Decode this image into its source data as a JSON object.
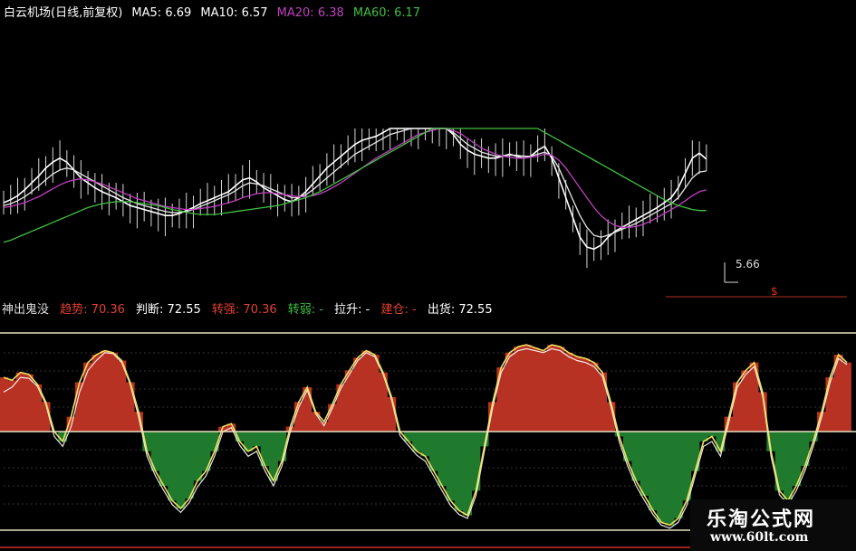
{
  "header": {
    "stock": "白云机场(日线,前复权)",
    "ma": [
      {
        "label": "MA5: 6.69",
        "color": "#ffffff"
      },
      {
        "label": "MA10: 6.57",
        "color": "#ffffff"
      },
      {
        "label": "MA20: 6.38",
        "color": "#c040c0"
      },
      {
        "label": "MA60: 6.17",
        "color": "#40c040"
      }
    ]
  },
  "indicator_header": {
    "items": [
      {
        "label": "神出鬼没",
        "color": "#dddddd"
      },
      {
        "label": "趋势: 70.36",
        "color": "#e04030"
      },
      {
        "label": "判断: 72.55",
        "color": "#ffffff"
      },
      {
        "label": "转强: 70.36",
        "color": "#e04030"
      },
      {
        "label": "转弱: -",
        "color": "#40c040"
      },
      {
        "label": "拉升: -",
        "color": "#ffffff"
      },
      {
        "label": "建仓: -",
        "color": "#e04030"
      },
      {
        "label": "出货: 72.55",
        "color": "#ffffff"
      }
    ]
  },
  "annotations": {
    "low_label": "5.66",
    "mark": "$"
  },
  "watermark": {
    "title": "乐淘公式网",
    "url": "www.60lt.com"
  },
  "colors": {
    "red_fill": "#b83224",
    "green_fill": "#1f7a2e",
    "yellow_line": "#f0e060",
    "ma5": "#ffffff",
    "ma20": "#c040c0",
    "ma60": "#40c040"
  },
  "chart_data": [
    {
      "type": "line",
      "x": [
        0,
        1,
        2,
        3,
        4,
        5,
        6,
        7,
        8,
        9,
        10,
        11,
        12,
        13,
        14,
        15,
        16,
        17,
        18,
        19,
        20,
        21,
        22,
        23,
        24,
        25,
        26,
        27,
        28,
        29,
        30,
        31,
        32,
        33,
        34,
        35,
        36,
        37,
        38,
        39,
        40,
        41,
        42,
        43,
        44,
        45,
        46,
        47,
        48,
        49,
        50,
        51,
        52,
        53,
        54,
        55,
        56,
        57,
        58,
        59,
        60,
        61,
        62,
        63,
        64,
        65,
        66,
        67,
        68,
        69,
        70,
        71,
        72,
        73,
        74,
        75,
        76,
        77,
        78,
        79,
        80,
        81,
        82,
        83,
        84,
        85,
        86,
        87,
        88,
        89,
        90,
        91,
        92,
        93,
        94,
        95,
        96,
        97,
        98,
        99,
        100,
        101,
        102,
        103,
        104,
        105,
        106,
        107,
        108,
        109,
        110,
        111,
        112,
        113,
        114,
        115,
        116,
        117,
        118,
        119,
        120
      ],
      "series": [
        {
          "name": "MA5",
          "values": [
            6.25,
            6.28,
            6.32,
            6.38,
            6.45,
            6.52,
            6.6,
            6.66,
            6.7,
            6.66,
            6.58,
            6.5,
            6.45,
            6.4,
            6.36,
            6.33,
            6.3,
            6.26,
            6.22,
            6.2,
            6.18,
            6.16,
            6.14,
            6.12,
            6.12,
            6.14,
            6.17,
            6.2,
            6.24,
            6.27,
            6.3,
            6.33,
            6.36,
            6.42,
            6.48,
            6.5,
            6.46,
            6.4,
            6.36,
            6.32,
            6.28,
            6.26,
            6.3,
            6.36,
            6.44,
            6.52,
            6.6,
            6.66,
            6.72,
            6.78,
            6.84,
            6.88,
            6.9,
            6.92,
            6.96,
            7.0,
            7.0,
            7.0,
            7.0,
            7.0,
            7.0,
            7.0,
            7.0,
            7.0,
            6.94,
            6.84,
            6.78,
            6.74,
            6.72,
            6.7,
            6.7,
            6.72,
            6.74,
            6.72,
            6.7,
            6.72,
            6.78,
            6.82,
            6.7,
            6.5,
            6.3,
            6.1,
            5.9,
            5.8,
            5.78,
            5.82,
            5.9,
            5.96,
            6.0,
            6.04,
            6.08,
            6.12,
            6.16,
            6.2,
            6.25,
            6.3,
            6.4,
            6.55,
            6.7,
            6.75,
            6.69
          ]
        },
        {
          "name": "MA10",
          "values": [
            6.22,
            6.24,
            6.27,
            6.31,
            6.36,
            6.42,
            6.48,
            6.54,
            6.58,
            6.6,
            6.58,
            6.54,
            6.5,
            6.46,
            6.42,
            6.38,
            6.34,
            6.3,
            6.27,
            6.24,
            6.22,
            6.2,
            6.18,
            6.16,
            6.15,
            6.15,
            6.16,
            6.18,
            6.21,
            6.24,
            6.27,
            6.3,
            6.33,
            6.37,
            6.42,
            6.45,
            6.44,
            6.42,
            6.39,
            6.36,
            6.33,
            6.3,
            6.3,
            6.33,
            6.38,
            6.44,
            6.5,
            6.56,
            6.62,
            6.68,
            6.74,
            6.78,
            6.82,
            6.86,
            6.9,
            6.94,
            6.96,
            6.98,
            7.0,
            7.0,
            7.0,
            7.0,
            7.0,
            7.0,
            6.96,
            6.9,
            6.84,
            6.8,
            6.76,
            6.74,
            6.72,
            6.72,
            6.73,
            6.73,
            6.72,
            6.72,
            6.74,
            6.76,
            6.72,
            6.6,
            6.44,
            6.28,
            6.12,
            6.0,
            5.92,
            5.9,
            5.92,
            5.95,
            5.98,
            6.01,
            6.04,
            6.08,
            6.12,
            6.16,
            6.2,
            6.24,
            6.3,
            6.4,
            6.5,
            6.56,
            6.57
          ]
        },
        {
          "name": "MA20",
          "values": [
            6.2,
            6.21,
            6.23,
            6.25,
            6.28,
            6.31,
            6.35,
            6.39,
            6.43,
            6.46,
            6.48,
            6.49,
            6.48,
            6.46,
            6.44,
            6.41,
            6.38,
            6.35,
            6.32,
            6.29,
            6.27,
            6.25,
            6.23,
            6.21,
            6.2,
            6.19,
            6.18,
            6.18,
            6.19,
            6.2,
            6.21,
            6.23,
            6.25,
            6.27,
            6.3,
            6.32,
            6.34,
            6.35,
            6.35,
            6.34,
            6.33,
            6.32,
            6.31,
            6.31,
            6.32,
            6.34,
            6.37,
            6.41,
            6.45,
            6.5,
            6.55,
            6.6,
            6.65,
            6.7,
            6.74,
            6.78,
            6.82,
            6.86,
            6.9,
            6.94,
            6.96,
            6.98,
            7.0,
            7.0,
            6.98,
            6.95,
            6.9,
            6.85,
            6.8,
            6.77,
            6.74,
            6.72,
            6.71,
            6.7,
            6.7,
            6.71,
            6.72,
            6.74,
            6.73,
            6.68,
            6.6,
            6.5,
            6.4,
            6.3,
            6.2,
            6.12,
            6.06,
            6.02,
            6.0,
            6.0,
            6.01,
            6.03,
            6.06,
            6.1,
            6.14,
            6.18,
            6.22,
            6.27,
            6.32,
            6.36,
            6.38
          ]
        },
        {
          "name": "MA60",
          "values": [
            5.85,
            5.87,
            5.9,
            5.93,
            5.96,
            5.99,
            6.02,
            6.05,
            6.08,
            6.11,
            6.14,
            6.17,
            6.2,
            6.22,
            6.24,
            6.25,
            6.26,
            6.26,
            6.26,
            6.25,
            6.24,
            6.23,
            6.22,
            6.2,
            6.18,
            6.17,
            6.15,
            6.14,
            6.13,
            6.13,
            6.13,
            6.14,
            6.15,
            6.16,
            6.17,
            6.18,
            6.19,
            6.2,
            6.21,
            6.22,
            6.24,
            6.26,
            6.28,
            6.3,
            6.33,
            6.36,
            6.4,
            6.44,
            6.48,
            6.52,
            6.56,
            6.6,
            6.64,
            6.68,
            6.72,
            6.76,
            6.8,
            6.84,
            6.88,
            6.92,
            6.96,
            7.0,
            7.0,
            7.0,
            7.0,
            7.0,
            7.0,
            7.0,
            7.0,
            7.0,
            7.0,
            7.0,
            7.0,
            7.0,
            7.0,
            7.0,
            7.0,
            6.96,
            6.92,
            6.88,
            6.84,
            6.8,
            6.76,
            6.72,
            6.68,
            6.64,
            6.6,
            6.56,
            6.52,
            6.48,
            6.44,
            6.4,
            6.36,
            6.32,
            6.28,
            6.25,
            6.22,
            6.2,
            6.18,
            6.17,
            6.17
          ]
        }
      ]
    },
    {
      "type": "area",
      "x": [
        0,
        1,
        2,
        3,
        4,
        5,
        6,
        7,
        8,
        9,
        10,
        11,
        12,
        13,
        14,
        15,
        16,
        17,
        18,
        19,
        20,
        21,
        22,
        23,
        24,
        25,
        26,
        27,
        28,
        29,
        30,
        31,
        32,
        33,
        34,
        35,
        36,
        37,
        38,
        39,
        40,
        41,
        42,
        43,
        44,
        45,
        46,
        47,
        48,
        49,
        50,
        51,
        52,
        53,
        54,
        55,
        56,
        57,
        58,
        59,
        60,
        61,
        62,
        63,
        64,
        65,
        66,
        67,
        68,
        69,
        70,
        71,
        72,
        73,
        74,
        75,
        76,
        77,
        78,
        79,
        80,
        81,
        82,
        83,
        84,
        85,
        86,
        87,
        88,
        89,
        90,
        91,
        92,
        93,
        94,
        95,
        96,
        97,
        98,
        99,
        100
      ],
      "series": [
        {
          "name": "趋势",
          "values": [
            55,
            52,
            60,
            58,
            48,
            30,
            0,
            -10,
            15,
            50,
            70,
            78,
            82,
            80,
            72,
            50,
            20,
            -20,
            -40,
            -55,
            -70,
            -78,
            -68,
            -50,
            -40,
            -20,
            5,
            8,
            -10,
            -20,
            -15,
            -35,
            -50,
            -30,
            5,
            30,
            45,
            20,
            10,
            28,
            48,
            62,
            75,
            82,
            78,
            60,
            35,
            0,
            -10,
            -20,
            -25,
            -40,
            -55,
            -70,
            -80,
            -85,
            -60,
            -15,
            30,
            65,
            80,
            86,
            88,
            85,
            82,
            88,
            86,
            80,
            76,
            74,
            70,
            60,
            30,
            -5,
            -30,
            -50,
            -65,
            -80,
            -92,
            -95,
            -88,
            -70,
            -40,
            -10,
            -5,
            -20,
            15,
            50,
            62,
            70,
            40,
            -20,
            -60,
            -70,
            -55,
            -35,
            -10,
            20,
            55,
            78,
            70
          ]
        },
        {
          "name": "判断",
          "values": [
            40,
            45,
            55,
            54,
            46,
            28,
            -5,
            -15,
            5,
            40,
            62,
            72,
            80,
            79,
            70,
            48,
            15,
            -25,
            -45,
            -60,
            -74,
            -82,
            -72,
            -56,
            -45,
            -25,
            0,
            4,
            -14,
            -25,
            -20,
            -40,
            -55,
            -35,
            0,
            25,
            42,
            18,
            6,
            24,
            44,
            58,
            72,
            80,
            76,
            58,
            32,
            -4,
            -14,
            -24,
            -30,
            -45,
            -60,
            -75,
            -84,
            -88,
            -65,
            -20,
            25,
            60,
            76,
            82,
            84,
            82,
            80,
            84,
            82,
            76,
            72,
            70,
            66,
            56,
            26,
            -10,
            -35,
            -55,
            -70,
            -84,
            -95,
            -98,
            -92,
            -75,
            -45,
            -15,
            -10,
            -25,
            10,
            45,
            58,
            66,
            36,
            -25,
            -64,
            -74,
            -60,
            -40,
            -15,
            15,
            50,
            74,
            68
          ]
        }
      ],
      "ylim": [
        -100,
        100
      ]
    }
  ]
}
